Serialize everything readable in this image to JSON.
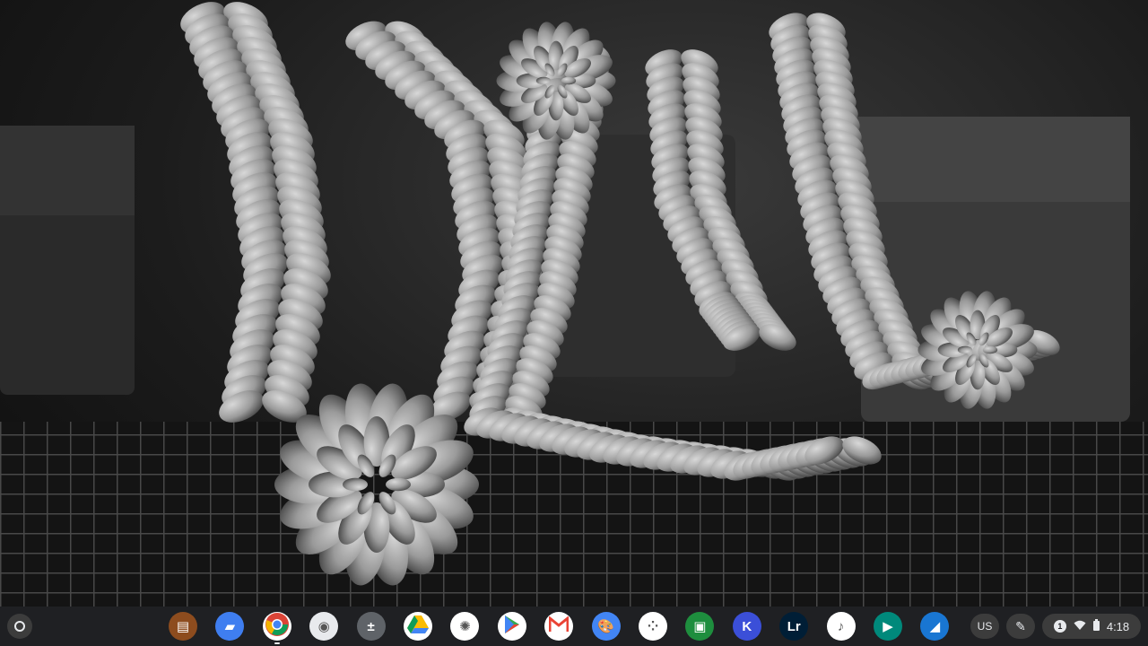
{
  "wallpaper": {
    "description_icon": "succulent-photo"
  },
  "shelf": {
    "apps": [
      {
        "name": "app-books",
        "icon": "book-icon",
        "color": "#8d4c1e",
        "glyph": "▤"
      },
      {
        "name": "app-files",
        "icon": "folder-icon",
        "color": "#3f7ef0",
        "glyph": "▰"
      },
      {
        "name": "app-chrome",
        "icon": "chrome-icon",
        "color": "#ffffff",
        "glyph": ""
      },
      {
        "name": "app-camera",
        "icon": "camera-icon",
        "color": "#e8eaed",
        "glyph": "◉"
      },
      {
        "name": "app-calculator",
        "icon": "calculator-icon",
        "color": "#5f6368",
        "glyph": "±"
      },
      {
        "name": "app-drive",
        "icon": "drive-icon",
        "color": "#ffffff",
        "glyph": "▲"
      },
      {
        "name": "app-photos",
        "icon": "pinwheel-icon",
        "color": "#ffffff",
        "glyph": "✺"
      },
      {
        "name": "app-play-store",
        "icon": "play-icon",
        "color": "#ffffff",
        "glyph": "▶"
      },
      {
        "name": "app-gmail",
        "icon": "mail-icon",
        "color": "#ffffff",
        "glyph": "M"
      },
      {
        "name": "app-canvas",
        "icon": "palette-icon",
        "color": "#4285f4",
        "glyph": "🎨"
      },
      {
        "name": "app-dots",
        "icon": "dots-icon",
        "color": "#ffffff",
        "glyph": "⁘"
      },
      {
        "name": "app-classroom",
        "icon": "classroom-icon",
        "color": "#1e8e3e",
        "glyph": "▣"
      },
      {
        "name": "app-kahoot",
        "icon": "k-letter-icon",
        "color": "#3b4fd8",
        "glyph": "K"
      },
      {
        "name": "app-lightroom",
        "icon": "lr-icon",
        "color": "#001e36",
        "glyph": "Lr"
      },
      {
        "name": "app-music",
        "icon": "music-icon",
        "color": "#ffffff",
        "glyph": "♪"
      },
      {
        "name": "app-meet",
        "icon": "video-icon",
        "color": "#00897b",
        "glyph": "▶"
      },
      {
        "name": "app-send",
        "icon": "send-icon",
        "color": "#1976d2",
        "glyph": "◢"
      }
    ],
    "ime": "US",
    "time": "4:18",
    "notification_count": "1",
    "colors": {
      "shelf_bg": "#202124",
      "pill_bg": "#3c3c3c",
      "text": "#e8eaed"
    }
  }
}
